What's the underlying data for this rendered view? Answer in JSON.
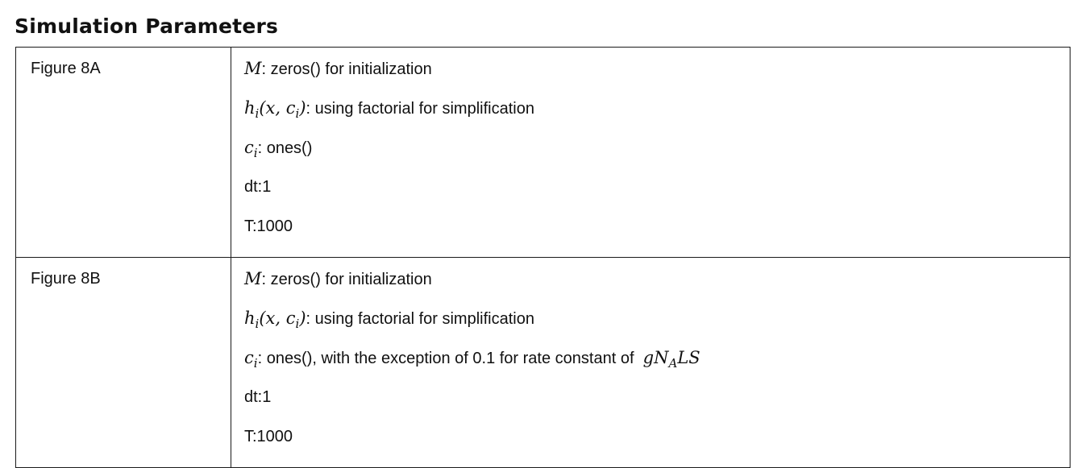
{
  "title": "Simulation Parameters",
  "rows": [
    {
      "label": "Figure 8A",
      "lines": [
        {
          "text": ": zeros() for initialization"
        },
        {
          "text": ": using factorial for simplification"
        },
        {
          "text": ": ones()"
        },
        {
          "text": "dt:1"
        },
        {
          "text": "T:1000"
        }
      ]
    },
    {
      "label": "Figure 8B",
      "lines": [
        {
          "text": ": zeros() for initialization"
        },
        {
          "text": ": using factorial for simplification"
        },
        {
          "text": ": ones(), with the exception of 0.1 for rate constant of"
        },
        {
          "text": "dt:1"
        },
        {
          "text": "T:1000"
        }
      ]
    }
  ],
  "symbols": {
    "M": "M",
    "h": "h",
    "h_sub": "i",
    "h_open": "(x, c",
    "h_inner_sub": "i",
    "h_close": ")",
    "c": "c",
    "c_sub": "i",
    "g_pre": "gN",
    "g_sub": "A",
    "g_post": "LS"
  }
}
